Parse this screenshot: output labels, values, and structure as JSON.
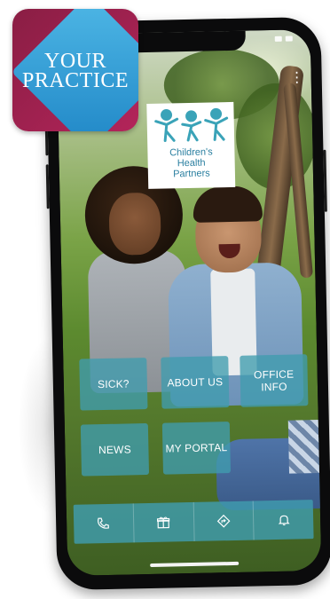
{
  "badge": {
    "line1": "YOUR",
    "line2": "PRACTICE",
    "colors": {
      "background": "#a3204f",
      "diamond": "#3aa6dc"
    }
  },
  "logo": {
    "line1": "Children's",
    "line2": "Health",
    "line3": "Partners",
    "color": "#2a7fa0"
  },
  "tiles": [
    {
      "label": "SICK?"
    },
    {
      "label": "ABOUT US"
    },
    {
      "label": "OFFICE INFO"
    },
    {
      "label": "NEWS"
    },
    {
      "label": "MY PORTAL"
    }
  ],
  "tab_bar": {
    "tabs": [
      {
        "icon": "phone-icon"
      },
      {
        "icon": "gift-icon"
      },
      {
        "icon": "directions-icon"
      },
      {
        "icon": "bell-icon"
      }
    ]
  },
  "accent_color": "#409cae"
}
